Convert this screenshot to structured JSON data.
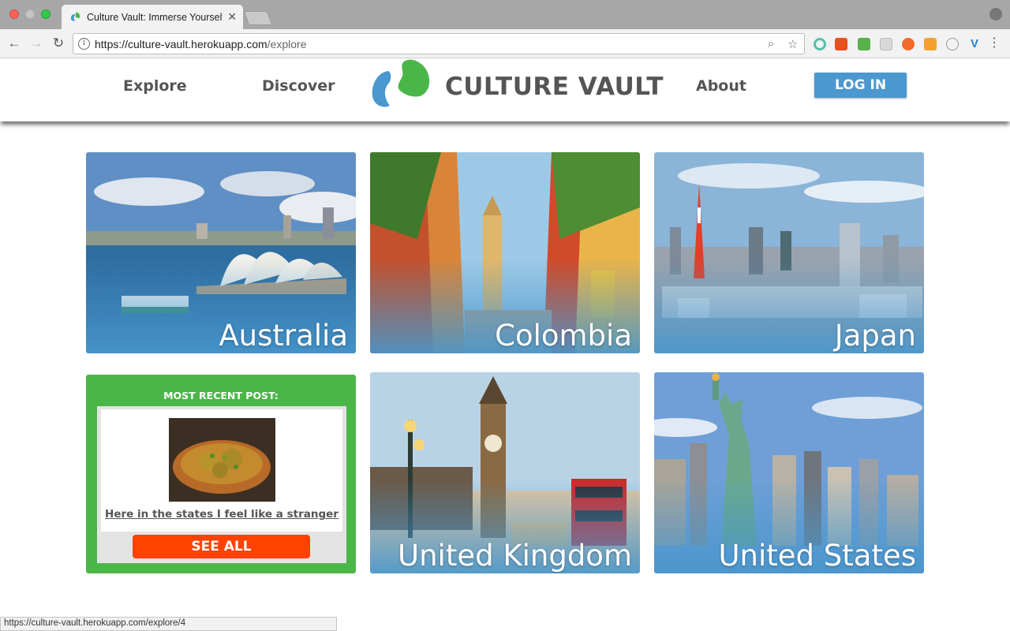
{
  "browser": {
    "tab_title": "Culture Vault: Immerse Yourself",
    "tab_close": "✕",
    "url_host": "https://culture-vault.herokuapp.com",
    "url_path": "/explore",
    "status_url": "https://culture-vault.herokuapp.com/explore/4"
  },
  "header": {
    "nav_explore": "Explore",
    "nav_discover": "Discover",
    "logo_text": "CULTURE VAULT",
    "nav_about": "About",
    "login_label": "LOG IN"
  },
  "countries": [
    {
      "label": "Australia"
    },
    {
      "label": "Colombia"
    },
    {
      "label": "Japan"
    },
    {
      "label": "United Kingdom"
    },
    {
      "label": "United States"
    }
  ],
  "recent_post": {
    "heading": "MOST RECENT POST:",
    "post_title": "Here in the states I feel like a stranger",
    "see_all_label": "SEE ALL"
  },
  "colors": {
    "accent_blue": "#4a98cf",
    "accent_green": "#4bb648",
    "accent_orange": "#ff4200"
  }
}
